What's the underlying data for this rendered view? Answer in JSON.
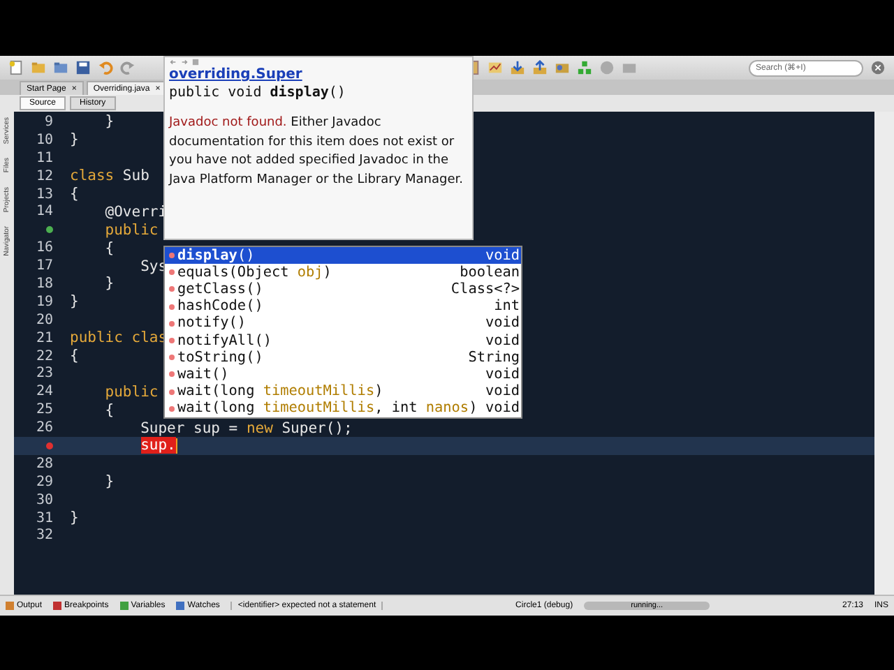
{
  "toolbar": {
    "search": {
      "placeholder": "Search (⌘+I)"
    }
  },
  "file_tabs": [
    {
      "label": "Start Page",
      "close": "×",
      "selected": false
    },
    {
      "label": "Overriding.java",
      "close": "×",
      "selected": true
    }
  ],
  "view_tabs": [
    {
      "label": "Source",
      "selected": true
    },
    {
      "label": "History",
      "selected": false
    }
  ],
  "side_panels": [
    "Services",
    "Files",
    "Projects",
    "Navigator"
  ],
  "editor": {
    "lines": [
      {
        "number": "9",
        "current": false,
        "tokens": [
          {
            "kind": "plain",
            "text": "    }"
          }
        ]
      },
      {
        "number": "10",
        "current": false,
        "tokens": [
          {
            "kind": "plain",
            "text": "}"
          }
        ]
      },
      {
        "number": "11",
        "current": false
      },
      {
        "number": "12",
        "current": false,
        "tokens": [
          {
            "kind": "kw",
            "text": "class"
          },
          {
            "kind": "plain",
            "text": " Sub"
          }
        ]
      },
      {
        "number": "13",
        "current": false,
        "tokens": [
          {
            "kind": "plain",
            "text": "{"
          }
        ]
      },
      {
        "number": "14",
        "current": false,
        "tokens": [
          {
            "kind": "plain",
            "text": "    @Overri"
          }
        ]
      },
      {
        "gutter_icon": {
          "kind": "override"
        },
        "current": false,
        "tokens": [
          {
            "kind": "kw",
            "text": "    public"
          }
        ]
      },
      {
        "number": "16",
        "current": false,
        "tokens": [
          {
            "kind": "plain",
            "text": "    {"
          }
        ]
      },
      {
        "number": "17",
        "current": false,
        "tokens": [
          {
            "kind": "plain",
            "text": "        Sys"
          }
        ]
      },
      {
        "number": "18",
        "current": false,
        "tokens": [
          {
            "kind": "plain",
            "text": "    }"
          }
        ]
      },
      {
        "number": "19",
        "current": false,
        "tokens": [
          {
            "kind": "plain",
            "text": "}"
          }
        ]
      },
      {
        "number": "20",
        "current": false
      },
      {
        "number": "21",
        "current": false,
        "tokens": [
          {
            "kind": "kw",
            "text": "public clas"
          }
        ]
      },
      {
        "number": "22",
        "current": false,
        "tokens": [
          {
            "kind": "plain",
            "text": "{"
          }
        ]
      },
      {
        "number": "23",
        "current": false
      },
      {
        "number": "24",
        "current": false,
        "tokens": [
          {
            "kind": "kw",
            "text": "    public"
          }
        ]
      },
      {
        "number": "25",
        "current": false,
        "tokens": [
          {
            "kind": "plain",
            "text": "    {"
          }
        ]
      },
      {
        "number": "26",
        "current": false,
        "tokens": [
          {
            "kind": "plain",
            "text": "        Super sup = "
          },
          {
            "kind": "kw",
            "text": "new"
          },
          {
            "kind": "plain",
            "text": " Super();"
          }
        ]
      },
      {
        "gutter_icon": {
          "kind": "error"
        },
        "current": true,
        "tokens": [
          {
            "kind": "error",
            "text": "sup."
          }
        ]
      },
      {
        "number": "28",
        "current": false
      },
      {
        "number": "29",
        "current": false,
        "tokens": [
          {
            "kind": "plain",
            "text": "    }"
          }
        ]
      },
      {
        "number": "30",
        "current": false
      },
      {
        "number": "31",
        "current": false,
        "tokens": [
          {
            "kind": "plain",
            "text": "}"
          }
        ]
      },
      {
        "number": "32",
        "current": false
      }
    ]
  },
  "javadoc": {
    "title": "overriding.Super",
    "signature": "public void **display**()",
    "notice": "Javadoc not found.",
    "message": " Either Javadoc documentation for this item does not exist or you have not added specified Javadoc in the Java Platform Manager or the Library Manager."
  },
  "completion": {
    "items": [
      {
        "selected": true,
        "type": "void",
        "tokens": [
          {
            "kind": "bold",
            "text": "display"
          },
          {
            "kind": "plain",
            "text": "()"
          }
        ]
      },
      {
        "selected": false,
        "type": "boolean",
        "tokens": [
          {
            "kind": "plain",
            "text": "equals(Object "
          },
          {
            "kind": "param",
            "text": "obj"
          },
          {
            "kind": "plain",
            "text": ")"
          }
        ]
      },
      {
        "selected": false,
        "type": "Class<?>",
        "tokens": [
          {
            "kind": "plain",
            "text": "getClass()"
          }
        ]
      },
      {
        "selected": false,
        "type": "int",
        "tokens": [
          {
            "kind": "plain",
            "text": "hashCode()"
          }
        ]
      },
      {
        "selected": false,
        "type": "void",
        "tokens": [
          {
            "kind": "plain",
            "text": "notify()"
          }
        ]
      },
      {
        "selected": false,
        "type": "void",
        "tokens": [
          {
            "kind": "plain",
            "text": "notifyAll()"
          }
        ]
      },
      {
        "selected": false,
        "type": "String",
        "tokens": [
          {
            "kind": "plain",
            "text": "toString()"
          }
        ]
      },
      {
        "selected": false,
        "type": "void",
        "tokens": [
          {
            "kind": "plain",
            "text": "wait()"
          }
        ]
      },
      {
        "selected": false,
        "type": "void",
        "tokens": [
          {
            "kind": "plain",
            "text": "wait(long "
          },
          {
            "kind": "param",
            "text": "timeoutMillis"
          },
          {
            "kind": "plain",
            "text": ")"
          }
        ]
      },
      {
        "selected": false,
        "type": "void",
        "tokens": [
          {
            "kind": "plain",
            "text": "wait(long "
          },
          {
            "kind": "param",
            "text": "timeoutMillis"
          },
          {
            "kind": "plain",
            "text": ", int "
          },
          {
            "kind": "param",
            "text": "nanos"
          },
          {
            "kind": "plain",
            "text": ")"
          }
        ]
      }
    ]
  },
  "status_bar": {
    "tabs": [
      "Output",
      "Breakpoints",
      "Variables",
      "Watches"
    ],
    "message": "<identifier> expected  not a statement",
    "project": "Circle1 (debug)",
    "progress": {
      "text": "running...",
      "level": 1
    },
    "position": "27:13",
    "mode": "INS"
  }
}
